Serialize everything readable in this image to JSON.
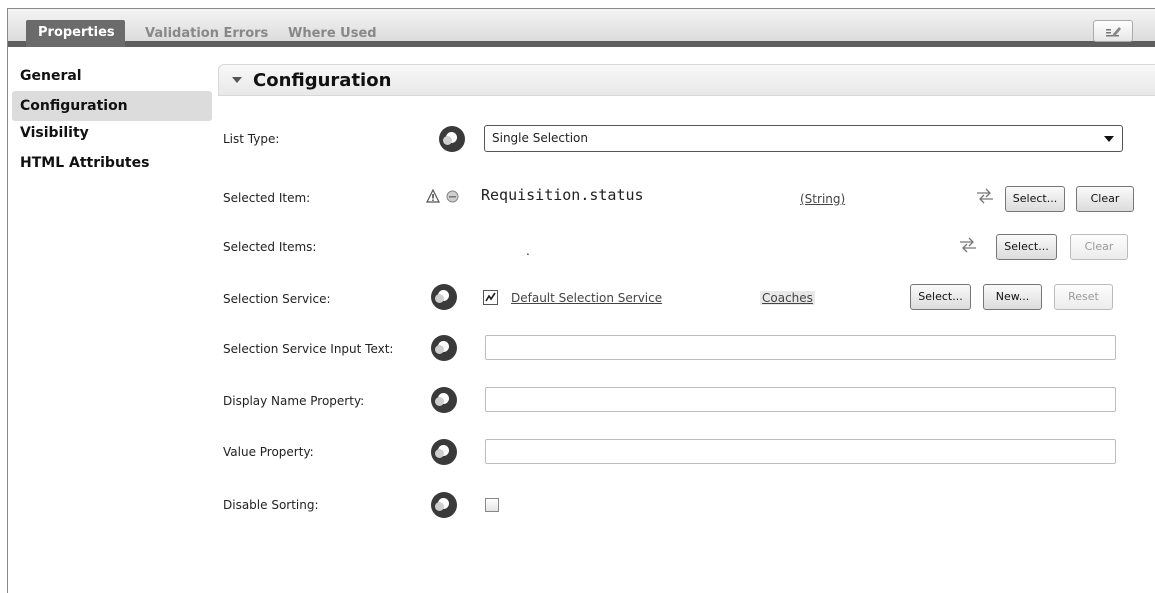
{
  "tabs": [
    {
      "label": "Properties",
      "active": true
    },
    {
      "label": "Validation Errors",
      "active": false
    },
    {
      "label": "Where Used",
      "active": false
    }
  ],
  "nav": {
    "items": [
      {
        "label": "General"
      },
      {
        "label": "Configuration",
        "selected": true
      },
      {
        "label": "Visibility"
      },
      {
        "label": "HTML Attributes"
      }
    ]
  },
  "section": {
    "title": "Configuration"
  },
  "config": {
    "list_type": {
      "label": "List Type:",
      "value": "Single Selection"
    },
    "selected_item": {
      "label": "Selected Item:",
      "value": "Requisition.status",
      "type": "(String)",
      "select_label": "Select...",
      "clear_label": "Clear"
    },
    "selected_items": {
      "label": "Selected Items:",
      "value": ".",
      "select_label": "Select...",
      "clear_label": "Clear"
    },
    "selection_service": {
      "label": "Selection Service:",
      "value": "Default Selection Service",
      "toolkit": "Coaches",
      "select_label": "Select...",
      "new_label": "New...",
      "reset_label": "Reset"
    },
    "service_input_text": {
      "label": "Selection Service Input Text:",
      "value": ""
    },
    "display_name_property": {
      "label": "Display Name Property:",
      "value": ""
    },
    "value_property": {
      "label": "Value Property:",
      "value": ""
    },
    "disable_sorting": {
      "label": "Disable Sorting:",
      "checked": false
    }
  }
}
